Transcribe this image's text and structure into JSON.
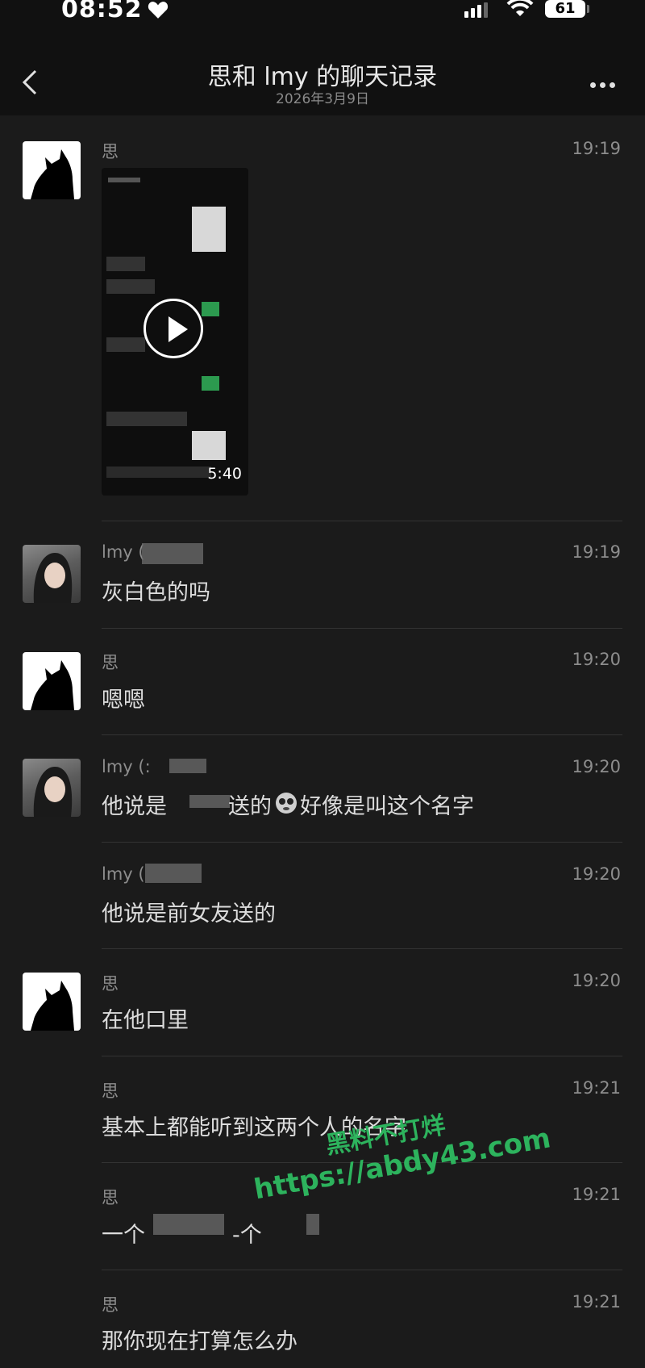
{
  "status_bar": {
    "time": "08:52",
    "battery": "61"
  },
  "nav": {
    "title": "思和 lmy 的聊天记录",
    "subtitle": "2026年3月9日"
  },
  "video": {
    "duration": "5:40"
  },
  "messages": [
    {
      "sender": "思",
      "time": "19:19",
      "text": ""
    },
    {
      "sender": "lmy (",
      "time": "19:19",
      "text": "灰白色的吗"
    },
    {
      "sender": "思",
      "time": "19:20",
      "text": "嗯嗯"
    },
    {
      "sender": "lmy (:",
      "time": "19:20",
      "text_parts": [
        "他说是",
        "送的",
        "好像是叫这个名字"
      ]
    },
    {
      "sender": "lmy (",
      "time": "19:20",
      "text": "他说是前女友送的"
    },
    {
      "sender": "思",
      "time": "19:20",
      "text": "在他口里"
    },
    {
      "sender": "思",
      "time": "19:21",
      "text": "基本上都能听到这两个人的名字"
    },
    {
      "sender": "思",
      "time": "19:21",
      "text_parts": [
        "一个",
        "-个"
      ]
    },
    {
      "sender": "思",
      "time": "19:21",
      "text": "那你现在打算怎么办"
    }
  ],
  "watermark": {
    "line1": "黑料不打烊",
    "line2": "https://abdy43.com"
  },
  "colors": {
    "background": "#1b1b1b",
    "bar": "#111111",
    "watermark": "#2db35d"
  }
}
